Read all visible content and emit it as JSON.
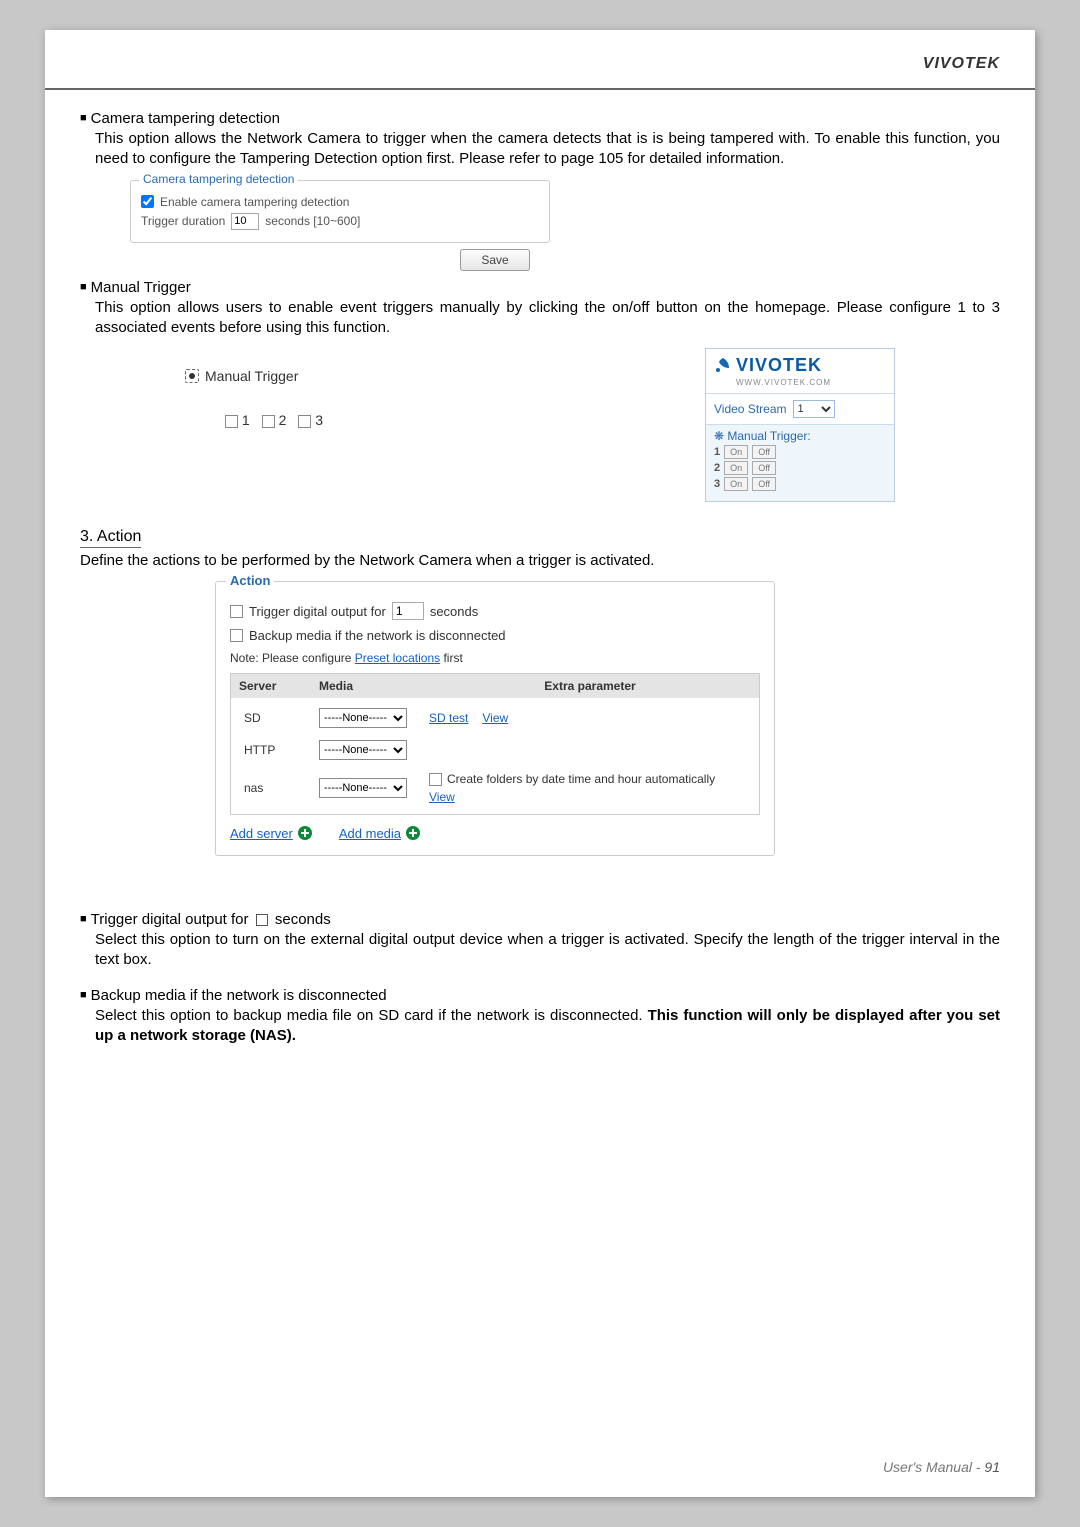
{
  "header": {
    "brand": "VIVOTEK"
  },
  "footer": {
    "label": "User's Manual - ",
    "page": "91"
  },
  "sec1": {
    "title": "Camera tampering detection",
    "body": "This option allows the Network Camera to trigger when the camera detects that is is being tampered with. To enable this function, you need to configure the Tampering Detection option first. Please refer to page 105 for detailed information."
  },
  "tamperBox": {
    "legend": "Camera tampering detection",
    "enableLabel": "Enable camera tampering detection",
    "durLabel": "Trigger duration",
    "durValue": "10",
    "durHint": "seconds [10~600]",
    "saveLabel": "Save"
  },
  "sec2": {
    "title": "Manual Trigger",
    "body": "This option allows users to enable event triggers manually by clicking the on/off button on the homepage. Please configure 1 to 3 associated events before using this function."
  },
  "mtLeft": {
    "radioLabel": "Manual Trigger",
    "opts": [
      "1",
      "2",
      "3"
    ]
  },
  "mtRight": {
    "logo": "VIVOTEK",
    "sub": "WWW.VIVOTEK.COM",
    "vsLabel": "Video Stream",
    "vsValue": "1",
    "panelLabel": "Manual Trigger:",
    "rows": [
      {
        "n": "1",
        "on": "On",
        "off": "Off"
      },
      {
        "n": "2",
        "on": "On",
        "off": "Off"
      },
      {
        "n": "3",
        "on": "On",
        "off": "Off"
      }
    ]
  },
  "sec3": {
    "heading": "3. Action",
    "body": "Define the actions to be performed by the Network Camera when a trigger is activated."
  },
  "actionBox": {
    "legend": "Action",
    "trigOutA": "Trigger digital output for",
    "trigOutVal": "1",
    "trigOutB": "seconds",
    "backupLabel": "Backup media if the network is disconnected",
    "noteA": "Note: Please configure ",
    "noteLink": "Preset locations",
    "noteB": " first",
    "headers": [
      "Server",
      "Media",
      "Extra parameter"
    ],
    "noneOpt": "-----None-----",
    "rows": [
      {
        "name": "SD",
        "extras": {
          "a": "SD test",
          "b": "View"
        }
      },
      {
        "name": "HTTP",
        "extras": {}
      },
      {
        "name": "nas",
        "extras": {
          "chkLabel": "Create folders by date time and hour automatically",
          "b": "View"
        }
      }
    ],
    "addServer": "Add server",
    "addMedia": "Add media"
  },
  "sec4": {
    "titleA": "Trigger digital output for ",
    "titleB": " seconds",
    "body": "Select this option to turn on the external digital output device when a trigger is activated. Specify the length of the trigger interval in the text box."
  },
  "sec5": {
    "title": "Backup media if the network is disconnected",
    "bodyA": "Select this option to backup media file on SD card if the network is disconnected. ",
    "bodyBold": "This function will only be displayed after you set up a network storage (NAS)."
  }
}
